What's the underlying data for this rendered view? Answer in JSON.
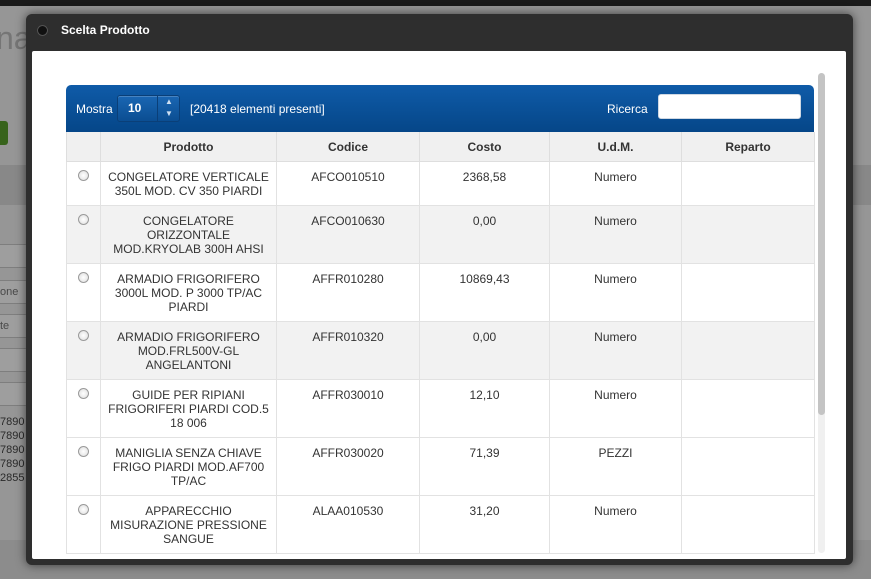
{
  "background": {
    "logo_fragment": "na",
    "field_fragments": [
      "one",
      "te"
    ],
    "numbers": [
      "7890",
      "7890",
      "7890",
      "7890",
      "2855"
    ]
  },
  "dialog": {
    "title": "Scelta Prodotto"
  },
  "toolbar": {
    "show_label": "Mostra",
    "page_length": "10",
    "info": "[20418 elementi presenti]",
    "search_label": "Ricerca",
    "search_value": ""
  },
  "table": {
    "columns": [
      "",
      "Prodotto",
      "Codice",
      "Costo",
      "U.d.M.",
      "Reparto"
    ],
    "rows": [
      {
        "prodotto": "CONGELATORE VERTICALE 350L MOD. CV 350 PIARDI",
        "codice": "AFCO010510",
        "costo": "2368,58",
        "udm": "Numero",
        "reparto": ""
      },
      {
        "prodotto": "CONGELATORE ORIZZONTALE MOD.KRYOLAB 300H AHSI",
        "codice": "AFCO010630",
        "costo": "0,00",
        "udm": "Numero",
        "reparto": ""
      },
      {
        "prodotto": "ARMADIO FRIGORIFERO 3000L MOD. P 3000 TP/AC PIARDI",
        "codice": "AFFR010280",
        "costo": "10869,43",
        "udm": "Numero",
        "reparto": ""
      },
      {
        "prodotto": "ARMADIO FRIGORIFERO MOD.FRL500V-GL ANGELANTONI",
        "codice": "AFFR010320",
        "costo": "0,00",
        "udm": "Numero",
        "reparto": ""
      },
      {
        "prodotto": "GUIDE PER RIPIANI FRIGORIFERI PIARDI COD.5 18 006",
        "codice": "AFFR030010",
        "costo": "12,10",
        "udm": "Numero",
        "reparto": ""
      },
      {
        "prodotto": "MANIGLIA SENZA CHIAVE FRIGO PIARDI MOD.AF700 TP/AC",
        "codice": "AFFR030020",
        "costo": "71,39",
        "udm": "PEZZI",
        "reparto": ""
      },
      {
        "prodotto": "APPARECCHIO MISURAZIONE PRESSIONE SANGUE",
        "codice": "ALAA010530",
        "costo": "31,20",
        "udm": "Numero",
        "reparto": ""
      }
    ]
  }
}
